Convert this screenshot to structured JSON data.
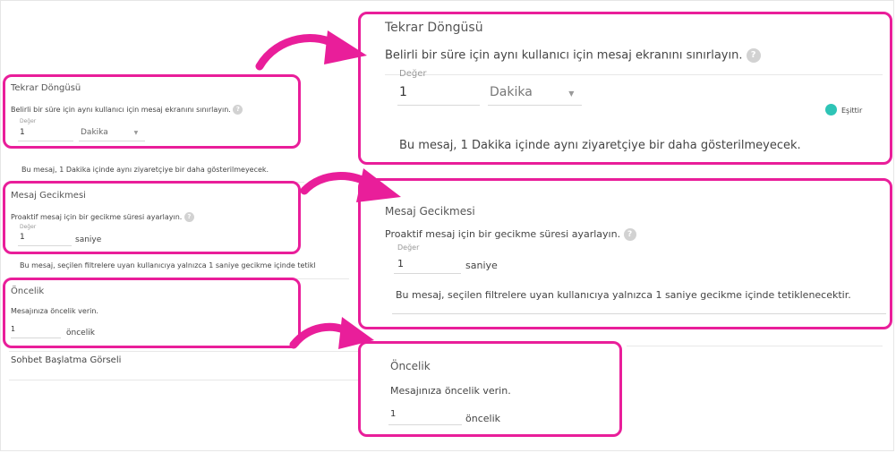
{
  "small": {
    "repeat": {
      "title": "Tekrar Döngüsü",
      "desc": "Belirli bir süre için aynı kullanıcı için mesaj ekranını sınırlayın.",
      "value_label": "Değer",
      "value": "1",
      "unit": "Dakika",
      "info": "Bu mesaj, 1 Dakika içinde aynı ziyaretçiye bir daha gösterilmeyecek."
    },
    "delay": {
      "title": "Mesaj Gecikmesi",
      "desc": "Proaktif mesaj için bir gecikme süresi ayarlayın.",
      "value_label": "Değer",
      "value": "1",
      "unit": "saniye",
      "info": "Bu mesaj, seçilen filtrelere uyan kullanıcıya yalnızca 1 saniye gecikme içinde tetikl"
    },
    "priority": {
      "title": "Öncelik",
      "desc": "Mesajınıza öncelik verin.",
      "value": "1",
      "unit": "öncelik"
    },
    "chat_visual": "Sohbet Başlatma Görseli"
  },
  "zoom": {
    "repeat": {
      "title": "Tekrar Döngüsü",
      "desc": "Belirli bir süre için aynı kullanıcı için mesaj ekranını sınırlayın.",
      "value_label": "Değer",
      "value": "1",
      "unit": "Dakika",
      "info": "Bu mesaj, 1 Dakika içinde aynı ziyaretçiye bir daha gösterilmeyecek.",
      "equal_label": "Eşittir"
    },
    "delay": {
      "title": "Mesaj Gecikmesi",
      "desc": "Proaktif mesaj için bir gecikme süresi ayarlayın.",
      "value_label": "Değer",
      "value": "1",
      "unit": "saniye",
      "info": "Bu mesaj, seçilen filtrelere uyan kullanıcıya yalnızca 1 saniye gecikme içinde tetiklenecektir."
    },
    "priority": {
      "title": "Öncelik",
      "desc": "Mesajınıza öncelik verin.",
      "value": "1",
      "unit": "öncelik"
    }
  },
  "help_glyph": "?",
  "colors": {
    "highlight": "#e91e9a",
    "toggle": "#2ec4b6"
  }
}
